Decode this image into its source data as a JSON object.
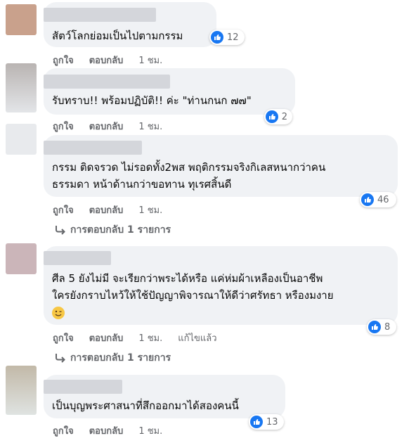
{
  "colors": {
    "like": "#1877f2",
    "bubble": "#f0f2f5",
    "meta": "#65676b"
  },
  "comments": [
    {
      "lines": [
        "สัตว์โลกย่อมเป็นไปตามกรรม"
      ],
      "reactions": "12",
      "actions": {
        "like": "ถูกใจ",
        "reply": "ตอบกลับ",
        "time": "1 ชม."
      }
    },
    {
      "lines": [
        "รับทราบ!! พร้อมปฏิบัติ!! ค่ะ \"ท่านกนก ๗๗\""
      ],
      "reactions": "2",
      "actions": {
        "like": "ถูกใจ",
        "reply": "ตอบกลับ",
        "time": "1 ชม."
      }
    },
    {
      "lines": [
        "กรรม ติดจรวด ไม่รอดทั้ง2พส พฤติกรรมจริงกิเลสหนากว่าคน",
        "ธรรมดา หน้าด้านกว่าขอทาน ทุเรศสิ้นดี"
      ],
      "reactions": "46",
      "actions": {
        "like": "ถูกใจ",
        "reply": "ตอบกลับ",
        "time": "1 ชม."
      },
      "replies": "การตอบกลับ 1 รายการ"
    },
    {
      "lines": [
        "ศีล 5 ยังไม่มี จะเรียกว่าพระได้หรือ แค่ห่มผ้าเหลืองเป็นอาชีพ",
        "ใครยังกราบไหว้ให้ใช้ปัญญาพิจารณาให้ดีว่าศรัทธา หรืองมงาย"
      ],
      "emoji": "wink-smile-emoji",
      "reactions": "8",
      "actions": {
        "like": "ถูกใจ",
        "reply": "ตอบกลับ",
        "time": "1 ชม.",
        "edited": "แก้ไขแล้ว"
      },
      "replies": "การตอบกลับ 1 รายการ"
    },
    {
      "lines": [
        "เป็นบุญพระศาสนาที่สึกออกมาได้สองคนนี้"
      ],
      "reactions": "13",
      "actions": {
        "like": "ถูกใจ",
        "reply": "ตอบกลับ",
        "time": "1 ชม."
      }
    }
  ],
  "icons": {
    "like": "thumbs-up-icon",
    "reply_arrow": "reply-arrow-icon"
  }
}
